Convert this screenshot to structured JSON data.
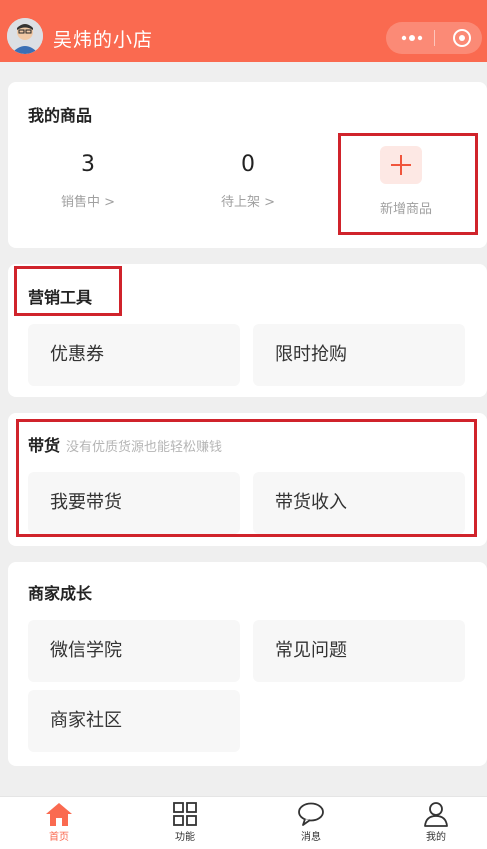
{
  "header": {
    "shop_name": "吴炜的小店"
  },
  "products": {
    "title": "我的商品",
    "stats": [
      {
        "value": "3",
        "label": "销售中 >"
      },
      {
        "value": "0",
        "label": "待上架 >"
      }
    ],
    "add_label": "新增商品"
  },
  "marketing": {
    "title": "营销工具",
    "items": [
      "优惠券",
      "限时抢购"
    ]
  },
  "daihuo": {
    "title": "带货",
    "subtitle": "没有优质货源也能轻松赚钱",
    "items": [
      "我要带货",
      "带货收入"
    ]
  },
  "growth": {
    "title": "商家成长",
    "items": [
      "微信学院",
      "常见问题",
      "商家社区"
    ]
  },
  "tabbar": {
    "tabs": [
      "首页",
      "功能",
      "消息",
      "我的"
    ],
    "active_color": "#fa6a50"
  },
  "colors": {
    "brand": "#fa6a50",
    "highlight": "#d0232b"
  }
}
